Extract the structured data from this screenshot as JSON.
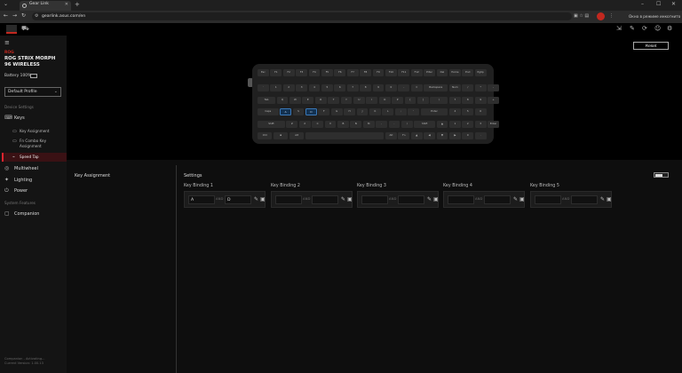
{
  "browser": {
    "tab_title": "Gear Link",
    "url": "gearlink.asus.com/en",
    "window_controls": [
      "–",
      "☐",
      "✕"
    ],
    "promo_text": "Окно в режиме инкогнито"
  },
  "app": {
    "reset_label": "Reset"
  },
  "sidebar": {
    "brand": "ROG",
    "device_name": "ROG STRIX MORPH 96 WIRELESS",
    "battery": "Battery 100%",
    "profile": "Default Profile",
    "device_settings_label": "Device Settings",
    "keys_label": "Keys",
    "sub_items": [
      "Key Assignment",
      "Fn Combo Key Assignment",
      "Speed Tap"
    ],
    "nav_items": [
      "Multiwheel",
      "Lighting",
      "Power"
    ],
    "system_features_label": "System Features",
    "companion_label": "Companion",
    "footer_line1": "Companion - Activating...",
    "footer_line2": "Current Version: 1.00.13"
  },
  "main": {
    "key_assignment_title": "Key Assignment",
    "settings_title": "Settings",
    "separator": "AND",
    "bindings": [
      {
        "label": "Key Binding 1",
        "key1": "A",
        "key2": "D"
      },
      {
        "label": "Key Binding 2",
        "key1": "",
        "key2": ""
      },
      {
        "label": "Key Binding 3",
        "key1": "",
        "key2": ""
      },
      {
        "label": "Key Binding 4",
        "key1": "",
        "key2": ""
      },
      {
        "label": "Key Binding 5",
        "key1": "",
        "key2": ""
      }
    ]
  },
  "keyboard": {
    "row1": [
      "Esc",
      "F1",
      "F2",
      "F3",
      "F4",
      "F5",
      "F6",
      "F7",
      "F8",
      "F9",
      "F10",
      "F11",
      "F12",
      "Prtsc",
      "Del",
      "Home",
      "End",
      "PgUp"
    ],
    "row2": [
      "`",
      "1",
      "2",
      "3",
      "4",
      "5",
      "6",
      "7",
      "8",
      "9",
      "0",
      "-",
      "=",
      "Backspace",
      "Num",
      "/",
      "*",
      "-"
    ],
    "row3": [
      "Tab",
      "Q",
      "W",
      "E",
      "R",
      "T",
      "Y",
      "U",
      "I",
      "O",
      "P",
      "[",
      "]",
      "\\",
      "7",
      "8",
      "9",
      "+"
    ],
    "row4": [
      "Caps",
      "A",
      "S",
      "D",
      "F",
      "G",
      "H",
      "J",
      "K",
      "L",
      ";",
      "'",
      "Enter",
      "4",
      "5",
      "6"
    ],
    "row5": [
      "Shift",
      "Z",
      "X",
      "C",
      "V",
      "B",
      "N",
      "M",
      ",",
      ".",
      "/",
      "Shift",
      "▲",
      "1",
      "2",
      "3",
      "Enter"
    ],
    "row6": [
      "Ctrl",
      "⊞",
      "Alt",
      "",
      "Alt",
      "Fn",
      "▲",
      "◀",
      "▼",
      "▶",
      "0",
      "."
    ],
    "highlight": [
      "A",
      "D"
    ]
  }
}
